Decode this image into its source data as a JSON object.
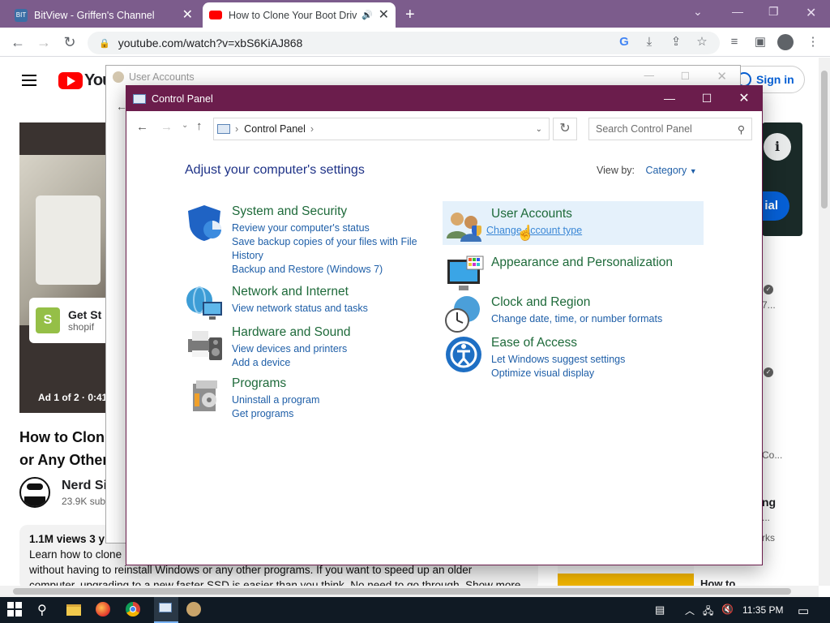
{
  "browser": {
    "tabs": [
      {
        "title": "BitView - Griffen's Channel",
        "favicon_color": "#3a6ea5"
      },
      {
        "title": "How to Clone Your Boot Driv",
        "favicon_color": "#ff0000"
      }
    ],
    "new_tab_label": "+",
    "url": "youtube.com/watch?v=xbS6KiAJ868"
  },
  "youtube": {
    "logo_text": "You",
    "sign_in": "Sign in",
    "ad_label": "Ad 1 of 2 · 0:41",
    "ad_card": {
      "title": "Get St",
      "subtitle": "shopif"
    },
    "video_title_line1": "How to Clon",
    "video_title_line2": "or Any Other",
    "channel_name": "Nerd Si",
    "subscribers": "23.9K sub",
    "views": "1.1M views  3 y",
    "description_line1": "Learn how to clone",
    "description_line2": "without having to reinstall Windows or any other programs. If you want to speed up an older",
    "description_line3": "computer, upgrading to a new faster SSD is easier than you think. No need to go through. Show more",
    "side_button": "ial",
    "side_text": [
      "7...",
      "Co...",
      "ng",
      "...",
      "rks"
    ],
    "side_bottom": "How to"
  },
  "user_accounts_window": {
    "title": "User Accounts"
  },
  "control_panel": {
    "title": "Control Panel",
    "breadcrumb": "Control Panel",
    "search_placeholder": "Search Control Panel",
    "heading": "Adjust your computer's settings",
    "view_by_label": "View by:",
    "view_by_value": "Category",
    "categories_left": [
      {
        "title": "System and Security",
        "links": [
          "Review your computer's status",
          "Save backup copies of your files with File History",
          "Backup and Restore (Windows 7)"
        ]
      },
      {
        "title": "Network and Internet",
        "links": [
          "View network status and tasks"
        ]
      },
      {
        "title": "Hardware and Sound",
        "links": [
          "View devices and printers",
          "Add a device"
        ]
      },
      {
        "title": "Programs",
        "links": [
          "Uninstall a program",
          "Get programs"
        ]
      }
    ],
    "categories_right": [
      {
        "title": "User Accounts",
        "links": [
          "Change account type"
        ]
      },
      {
        "title": "Appearance and Personalization",
        "links": []
      },
      {
        "title": "Clock and Region",
        "links": [
          "Change date, time, or number formats"
        ]
      },
      {
        "title": "Ease of Access",
        "links": [
          "Let Windows suggest settings",
          "Optimize visual display"
        ]
      }
    ]
  },
  "taskbar": {
    "time": "11:35 PM"
  },
  "colors": {
    "cp_titlebar": "#6b1d4c",
    "chrome_frame": "#7c5c8c",
    "link": "#1f5fa8",
    "category_title": "#1e6a3a"
  }
}
